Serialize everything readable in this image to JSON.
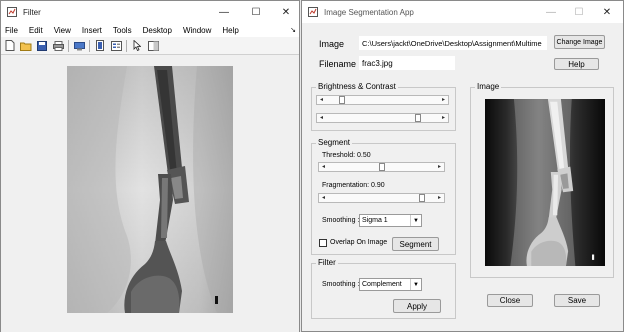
{
  "filter_window": {
    "title": "Filter",
    "minimize": "—",
    "maximize": "☐",
    "close": "✕",
    "menu": [
      "File",
      "Edit",
      "View",
      "Insert",
      "Tools",
      "Desktop",
      "Window",
      "Help"
    ],
    "toolbar_icons": [
      "new-file-icon",
      "open-folder-icon",
      "save-icon",
      "print-icon",
      "print-preview-icon",
      "link-icon",
      "insert-legend-icon",
      "pointer-icon",
      "property-editor-icon"
    ]
  },
  "seg_window": {
    "title": "Image Segmentation App",
    "minimize": "—",
    "maximize": "☐",
    "close": "✕",
    "image_label": "Image",
    "image_path": "C:\\Users\\jackt\\OneDrive\\Desktop\\Assignment\\Multime",
    "change_image": "Change Image",
    "filename_label": "Filename",
    "filename_value": "frac3.jpg",
    "help": "Help",
    "brightness_panel": "Brightness & Contrast",
    "brightness_level": 0.12,
    "contrast_level": 0.83,
    "segment_panel": "Segment",
    "threshold_label": "Threshold: 0.50",
    "threshold_level": 0.5,
    "fragmentation_label": "Fragmentation: 0.90",
    "fragmentation_level": 0.9,
    "smoothing_label": "Smoothing :",
    "smoothing_value": "Sigma 1",
    "overlap_label": "Overlap On Image",
    "overlap_checked": false,
    "segment_button": "Segment",
    "filter_panel": "Filter",
    "filter_smoothing_label": "Smoothing :",
    "filter_smoothing_value": "Complement",
    "apply": "Apply",
    "image_panel": "Image",
    "close_button": "Close",
    "save_button": "Save"
  }
}
